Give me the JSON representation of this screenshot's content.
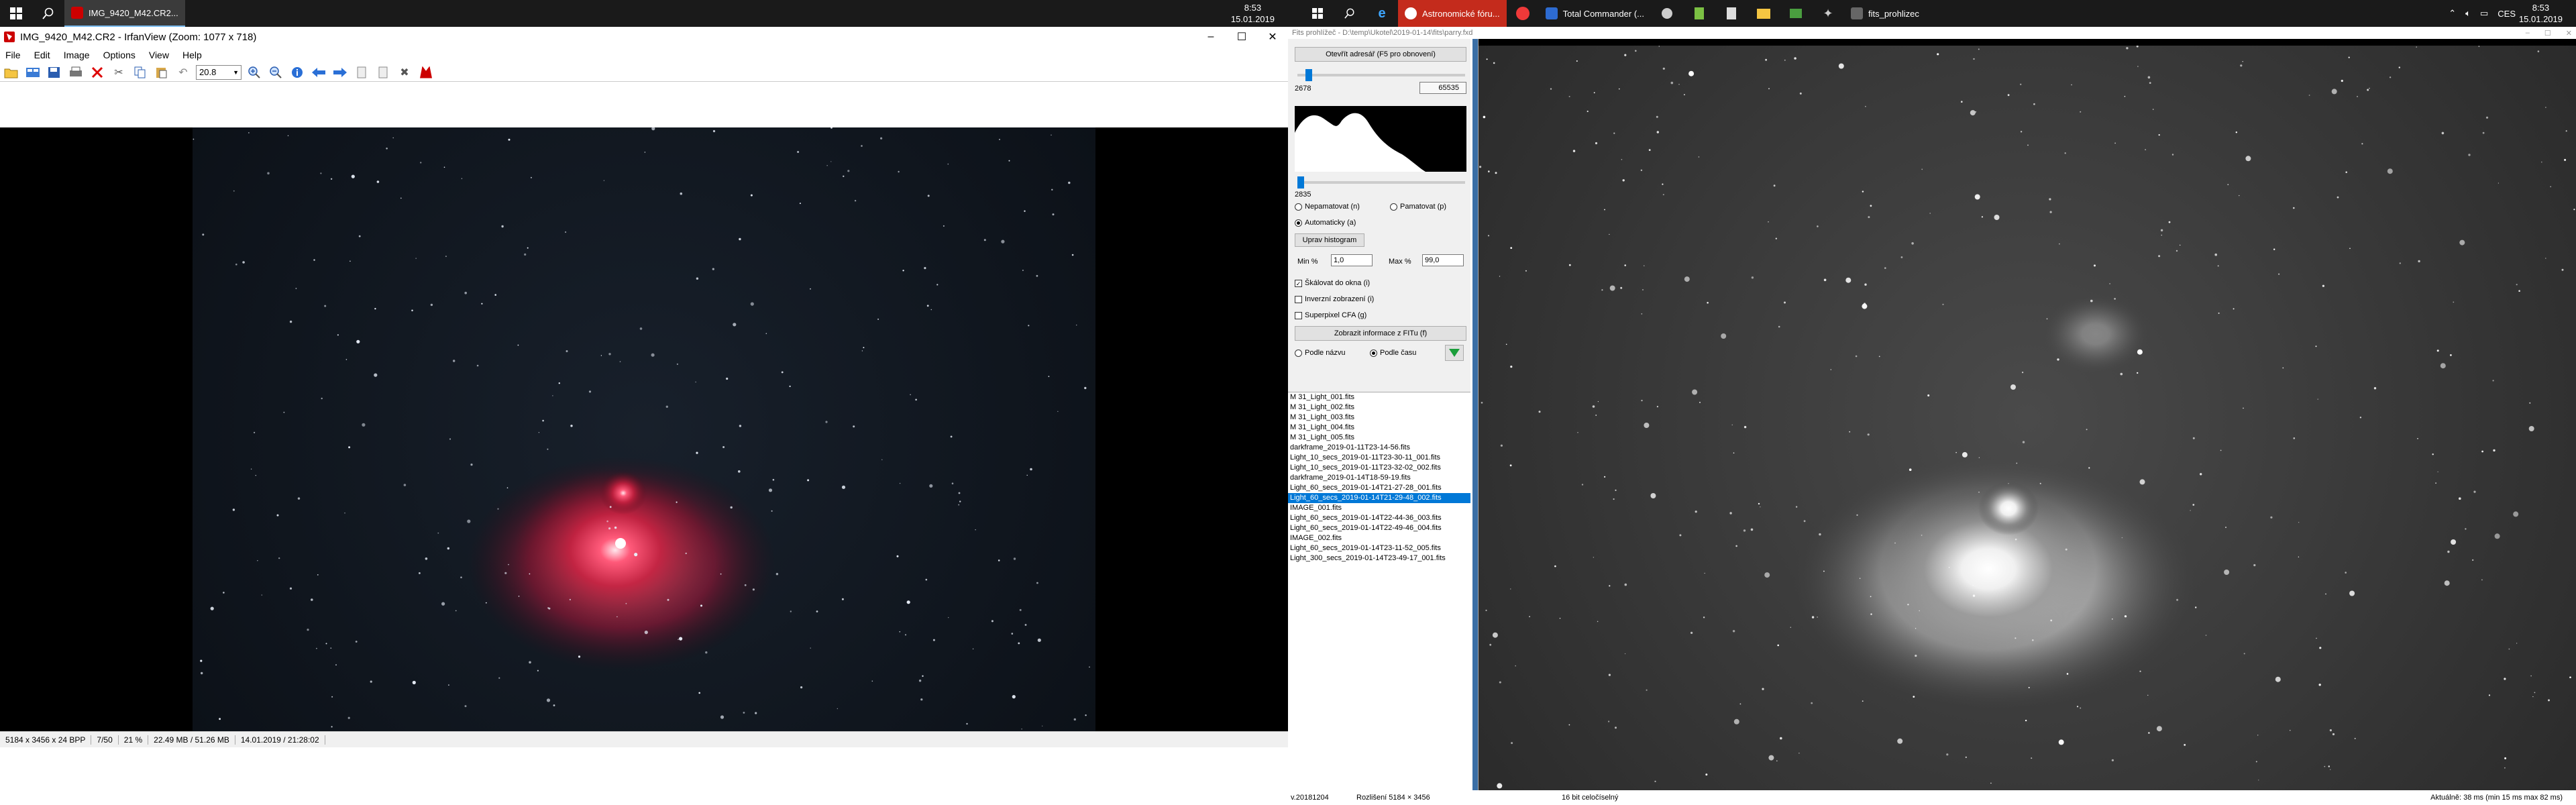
{
  "taskbar_left": {
    "app": "IMG_9420_M42.CR2...",
    "clock_time": "8:53",
    "clock_date": "15.01.2019"
  },
  "taskbar_right": {
    "apps": [
      "Astronomické fóru...",
      "Total Commander (...",
      "fits_prohlizec"
    ],
    "lang": "CES",
    "clock_time": "8:53",
    "clock_date": "15.01.2019"
  },
  "irfan": {
    "title": "IMG_9420_M42.CR2 - IrfanView (Zoom: 1077 x 718)",
    "menu": [
      "File",
      "Edit",
      "Image",
      "Options",
      "View",
      "Help"
    ],
    "zoom": "20.8",
    "status": [
      "5184 x 3456 x 24 BPP",
      "7/50",
      "21 %",
      "22.49 MB / 51.26 MB",
      "14.01.2019 / 21:28:02"
    ],
    "controls": {
      "minimize": "–",
      "maximize": "☐",
      "close": "✕"
    }
  },
  "fits": {
    "title": "Fits prohlížeč - D:\\temp\\Ukotel\\2019-01-14\\fits\\parry.fxd",
    "open_dir": "Otevřít adresář (F5 pro obnovení)",
    "slider_top_value": "2678",
    "slider_top_max": "65535",
    "slider_bottom_value": "2835",
    "radio_nepamatovat": "Nepamatovat (n)",
    "radio_pamatovat": "Pamatovat (p)",
    "radio_automaticky": "Automaticky (a)",
    "uprav_histogram": "Uprav histogram",
    "min_label": "Min %",
    "min_value": "1,0",
    "max_label": "Max %",
    "max_value": "99,0",
    "chk_skalovat": "Škálovat do okna (i)",
    "chk_inverzni": "Inverzní zobrazení (i)",
    "chk_superpixel": "Superpixel CFA (g)",
    "zobrazit_info": "Zobrazit informace z FITu (f)",
    "sort_nazev": "Podle názvu",
    "sort_cas": "Podle času",
    "files": [
      "M 31_Light_001.fits",
      "M 31_Light_002.fits",
      "M 31_Light_003.fits",
      "M 31_Light_004.fits",
      "M 31_Light_005.fits",
      "darkframe_2019-01-11T23-14-56.fits",
      "Light_10_secs_2019-01-11T23-30-11_001.fits",
      "Light_10_secs_2019-01-11T23-32-02_002.fits",
      "darkframe_2019-01-14T18-59-19.fits",
      "Light_60_secs_2019-01-14T21-27-28_001.fits",
      "Light_60_secs_2019-01-14T21-29-48_002.fits",
      "IMAGE_001.fits",
      "Light_60_secs_2019-01-14T22-44-36_003.fits",
      "Light_60_secs_2019-01-14T22-49-46_004.fits",
      "IMAGE_002.fits",
      "Light_60_secs_2019-01-14T23-11-52_005.fits",
      "Light_300_secs_2019-01-14T23-49-17_001.fits"
    ],
    "selected_index": 10,
    "status_version": "v.20181204",
    "status_resolution": "Rozlišení 5184 × 3456",
    "status_bits": "16 bit celočíselný",
    "status_time": "Aktuálně: 38 ms (min 15 ms  max 82 ms)"
  },
  "colors": {
    "accent": "#0078d7",
    "nebula": "#e0304a",
    "taskbar": "#1a1a1a"
  }
}
